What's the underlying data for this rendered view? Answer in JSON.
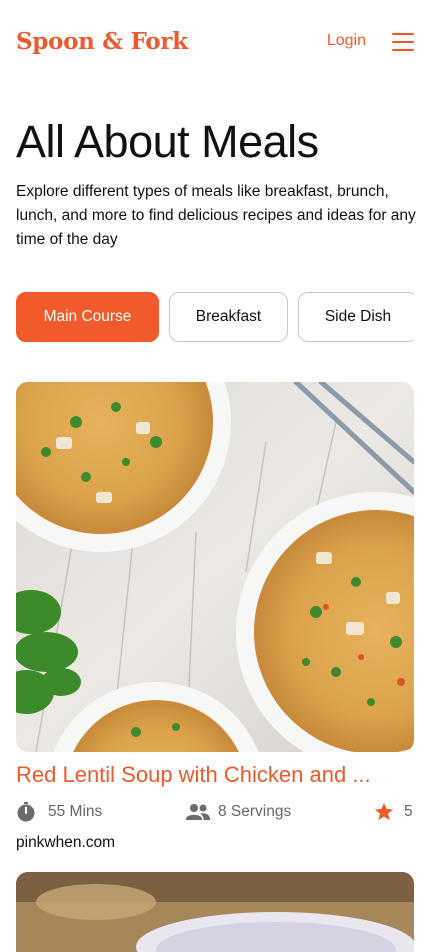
{
  "brand": {
    "logo": "Spoon & Fork",
    "accent": "#ee5a2f"
  },
  "header": {
    "login_label": "Login",
    "menu_icon": "hamburger-menu-icon"
  },
  "page": {
    "title": "All About Meals",
    "subtitle": "Explore different types of meals like breakfast, brunch, lunch, and more to find delicious recipes and ideas for any time of the day"
  },
  "categories": [
    {
      "label": "Main Course",
      "active": true
    },
    {
      "label": "Breakfast",
      "active": false
    },
    {
      "label": "Side Dish",
      "active": false
    }
  ],
  "recipes": [
    {
      "title": "Red Lentil Soup with Chicken and ...",
      "time": "55 Mins",
      "servings": "8 Servings",
      "rating": "5",
      "source": "pinkwhen.com",
      "time_icon": "stopwatch-icon",
      "servings_icon": "people-icon",
      "rating_icon": "star-icon"
    }
  ]
}
